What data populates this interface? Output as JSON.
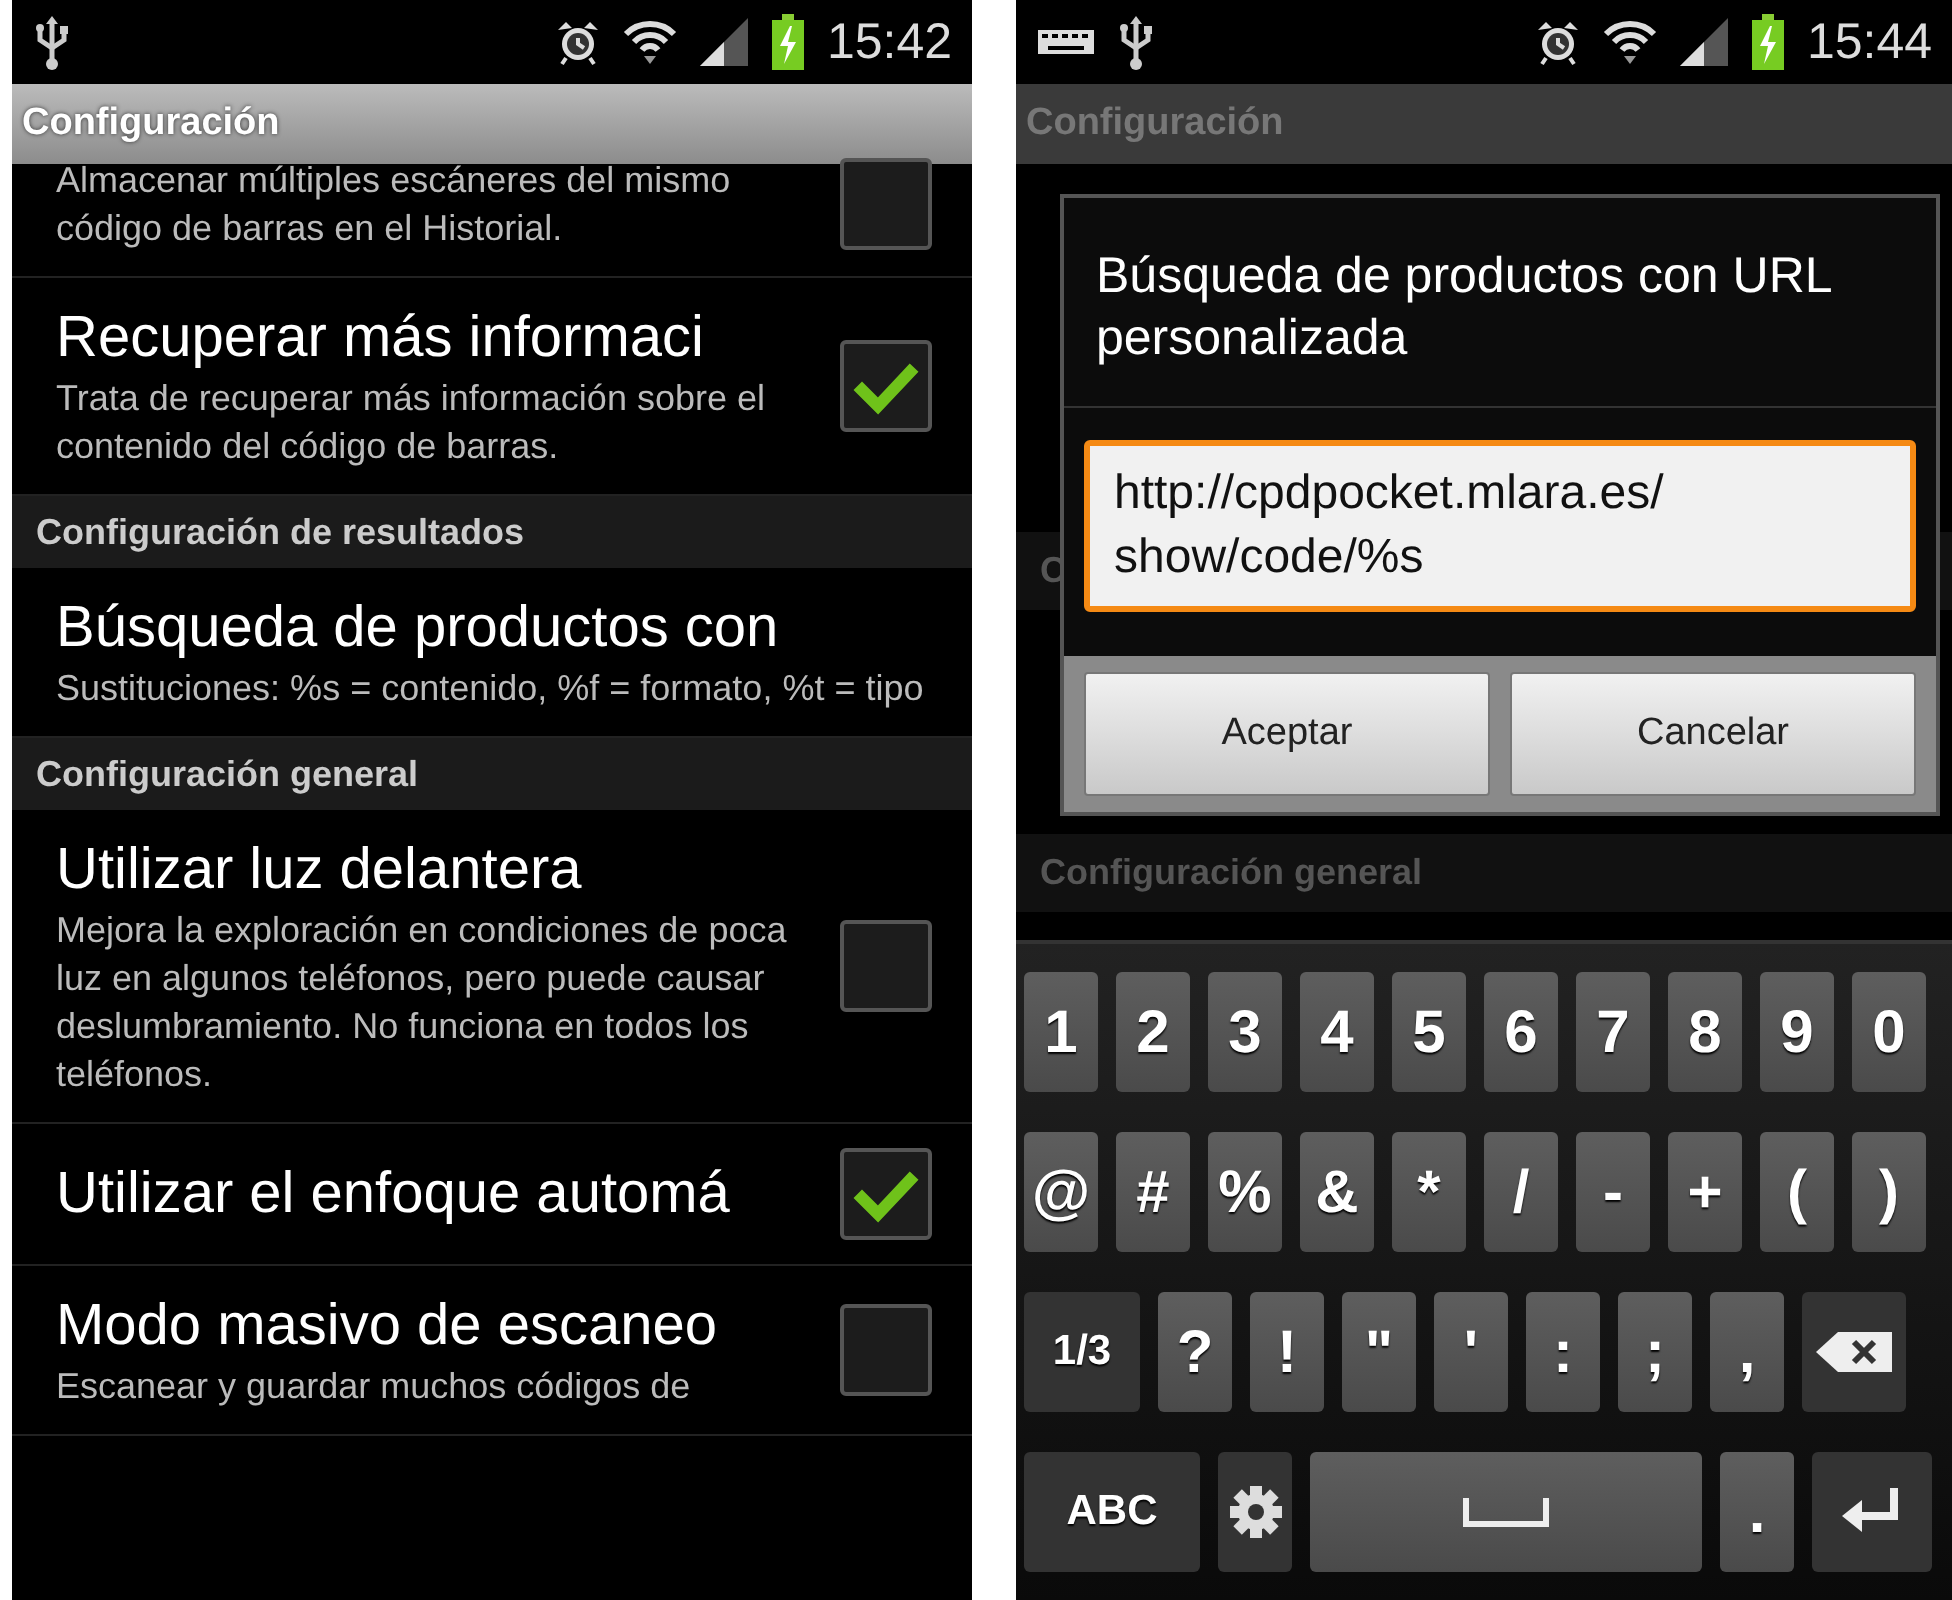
{
  "left_screen": {
    "status_bar": {
      "time": "15:42"
    },
    "action_bar": {
      "title": "Configuración"
    },
    "preferences": [
      {
        "kind": "check",
        "summary": "Almacenar múltiples escáneres del mismo código de barras en el Historial.",
        "checked": false
      },
      {
        "kind": "check",
        "title": "Recuperar más informaci",
        "summary": "Trata de recuperar más información sobre el contenido del código de barras.",
        "checked": true
      },
      {
        "kind": "category",
        "title": "Configuración de resultados"
      },
      {
        "kind": "text",
        "title": "Búsqueda de productos con",
        "summary": "Sustituciones: %s = contenido, %f = formato, %t = tipo"
      },
      {
        "kind": "category",
        "title": "Configuración general"
      },
      {
        "kind": "check",
        "title": "Utilizar luz delantera",
        "summary": "Mejora la exploración en condiciones de poca luz en algunos teléfonos, pero puede causar deslumbramiento. No funciona en todos los teléfonos.",
        "checked": false
      },
      {
        "kind": "check",
        "title": "Utilizar el enfoque automá",
        "checked": true
      },
      {
        "kind": "check",
        "title": "Modo masivo de escaneo",
        "summary": "Escanear y guardar muchos códigos de",
        "checked": false
      }
    ]
  },
  "right_screen": {
    "status_bar": {
      "time": "15:44"
    },
    "action_bar": {
      "title": "Configuración"
    },
    "background_categories": [
      "C",
      "Configuración general"
    ],
    "dialog": {
      "title": "Búsqueda de productos con URL personalizada",
      "value": "http://cpdpocket.mlara.es/ show/code/%s",
      "buttons": [
        "Aceptar",
        "Cancelar"
      ]
    },
    "keyboard": {
      "rows": [
        [
          {
            "kind": "char",
            "label": "1"
          },
          {
            "kind": "char",
            "label": "2"
          },
          {
            "kind": "char",
            "label": "3"
          },
          {
            "kind": "char",
            "label": "4"
          },
          {
            "kind": "char",
            "label": "5"
          },
          {
            "kind": "char",
            "label": "6"
          },
          {
            "kind": "char",
            "label": "7"
          },
          {
            "kind": "char",
            "label": "8"
          },
          {
            "kind": "char",
            "label": "9"
          },
          {
            "kind": "char",
            "label": "0"
          }
        ],
        [
          {
            "kind": "char",
            "label": "@"
          },
          {
            "kind": "char",
            "label": "#"
          },
          {
            "kind": "char",
            "label": "%"
          },
          {
            "kind": "char",
            "label": "&"
          },
          {
            "kind": "char",
            "label": "*"
          },
          {
            "kind": "char",
            "label": "/"
          },
          {
            "kind": "char",
            "label": "-"
          },
          {
            "kind": "char",
            "label": "+"
          },
          {
            "kind": "char",
            "label": "("
          },
          {
            "kind": "char",
            "label": ")"
          }
        ],
        [
          {
            "kind": "mode",
            "label": "1/3"
          },
          {
            "kind": "char",
            "label": "?"
          },
          {
            "kind": "char",
            "label": "!"
          },
          {
            "kind": "char",
            "label": "\""
          },
          {
            "kind": "char",
            "label": "'"
          },
          {
            "kind": "char",
            "label": ":"
          },
          {
            "kind": "char",
            "label": ";"
          },
          {
            "kind": "char",
            "label": ","
          },
          {
            "kind": "backspace"
          }
        ],
        [
          {
            "kind": "mode",
            "label": "ABC"
          },
          {
            "kind": "settings"
          },
          {
            "kind": "space"
          },
          {
            "kind": "char",
            "label": "."
          },
          {
            "kind": "enter"
          }
        ]
      ]
    }
  }
}
